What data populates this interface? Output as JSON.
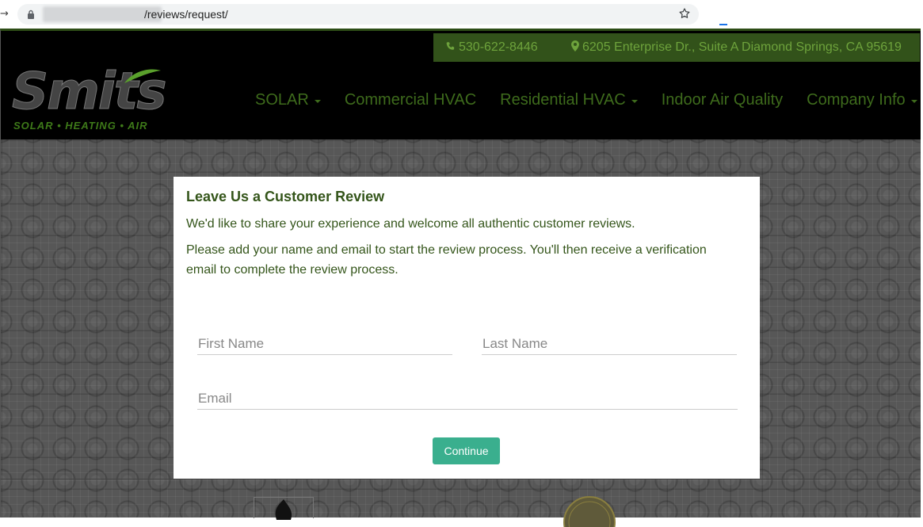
{
  "browser": {
    "url_path": "/reviews/request/"
  },
  "header": {
    "phone": "530-622-8446",
    "address": "6205 Enterprise Dr., Suite A Diamond Springs, CA 95619",
    "logo_word": "Smits",
    "logo_tagline": "SOLAR • HEATING • AIR",
    "nav": [
      {
        "label": "SOLAR",
        "has_dropdown": true
      },
      {
        "label": "Commercial HVAC",
        "has_dropdown": false
      },
      {
        "label": "Residential HVAC",
        "has_dropdown": true
      },
      {
        "label": "Indoor Air Quality",
        "has_dropdown": false
      },
      {
        "label": "Company Info",
        "has_dropdown": true
      }
    ]
  },
  "review_form": {
    "title": "Leave Us a Customer Review",
    "intro": "We'd like to share your experience and welcome all authentic customer reviews.",
    "instructions": "Please add your name and email to start the review process. You'll then receive a verification email to complete the review process.",
    "first_name_placeholder": "First Name",
    "last_name_placeholder": "Last Name",
    "email_placeholder": "Email",
    "first_name_value": "",
    "last_name_value": "",
    "email_value": "",
    "continue_label": "Continue"
  },
  "colors": {
    "brand_green": "#3e6b1c",
    "contact_strip": "#32521a",
    "button": "#3aaf8e"
  },
  "icons": [
    "lock-icon",
    "bookmark-star-icon",
    "phone-icon",
    "map-marker-icon",
    "caret-down-icon",
    "flame-icon",
    "verified-badge-icon"
  ]
}
